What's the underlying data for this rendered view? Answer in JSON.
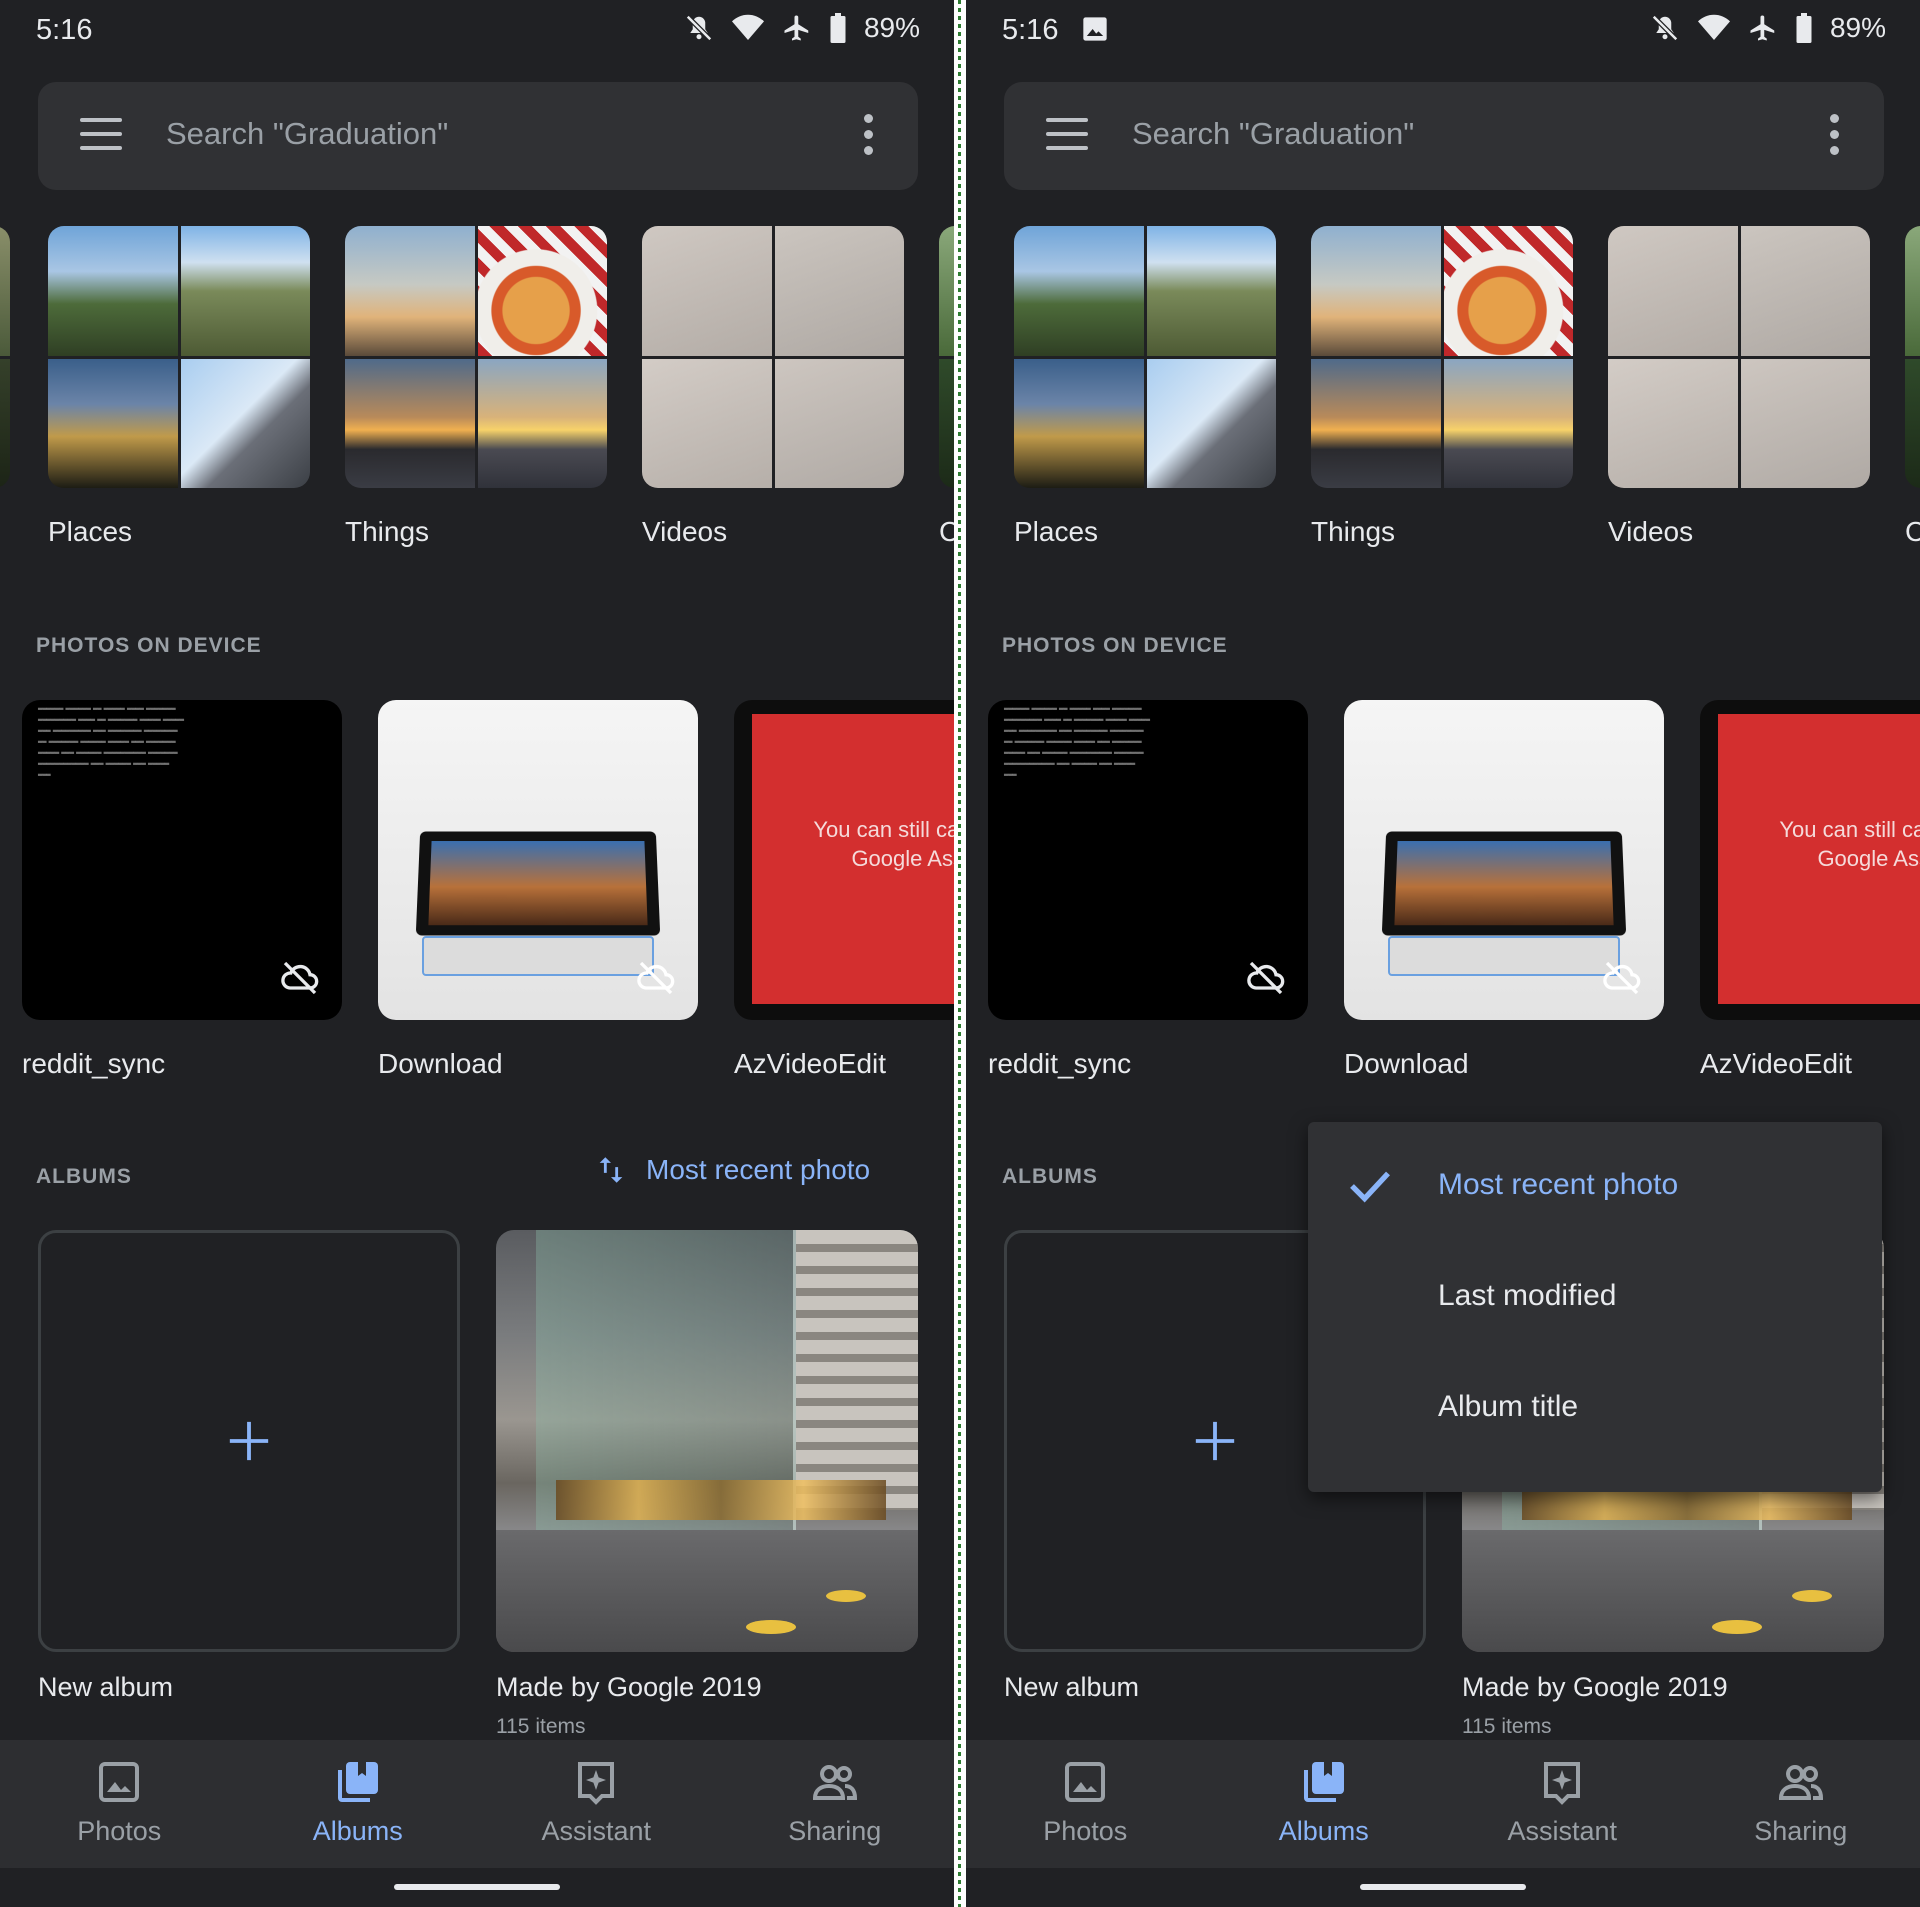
{
  "status_bar": {
    "time": "5:16",
    "battery": "89%"
  },
  "search": {
    "placeholder": "Search \"Graduation\""
  },
  "categories": [
    {
      "label": "Places"
    },
    {
      "label": "Things"
    },
    {
      "label": "Videos"
    },
    {
      "label": "C"
    }
  ],
  "photos_on_device": {
    "heading": "PHOTOS ON DEVICE",
    "folders": [
      {
        "label": "reddit_sync"
      },
      {
        "label": "Download"
      },
      {
        "label": "AzVideoEdit",
        "banner_text": "You can still call me your Google Assistant"
      }
    ]
  },
  "albums": {
    "heading": "ALBUMS",
    "sort_label": "Most recent photo",
    "items": [
      {
        "title": "New album"
      },
      {
        "title": "Made by Google 2019",
        "count": "115 items"
      }
    ]
  },
  "sort_menu": {
    "options": [
      {
        "label": "Most recent photo",
        "selected": true
      },
      {
        "label": "Last modified",
        "selected": false
      },
      {
        "label": "Album title",
        "selected": false
      }
    ]
  },
  "bottom_nav": [
    {
      "label": "Photos",
      "icon": "photo-icon",
      "active": false
    },
    {
      "label": "Albums",
      "icon": "albums-icon",
      "active": true
    },
    {
      "label": "Assistant",
      "icon": "assistant-icon",
      "active": false
    },
    {
      "label": "Sharing",
      "icon": "sharing-icon",
      "active": false
    }
  ],
  "colors": {
    "background": "#202124",
    "surface": "#303134",
    "accent": "#8ab4f8",
    "text": "#e8eaed",
    "muted": "#9aa0a6"
  }
}
